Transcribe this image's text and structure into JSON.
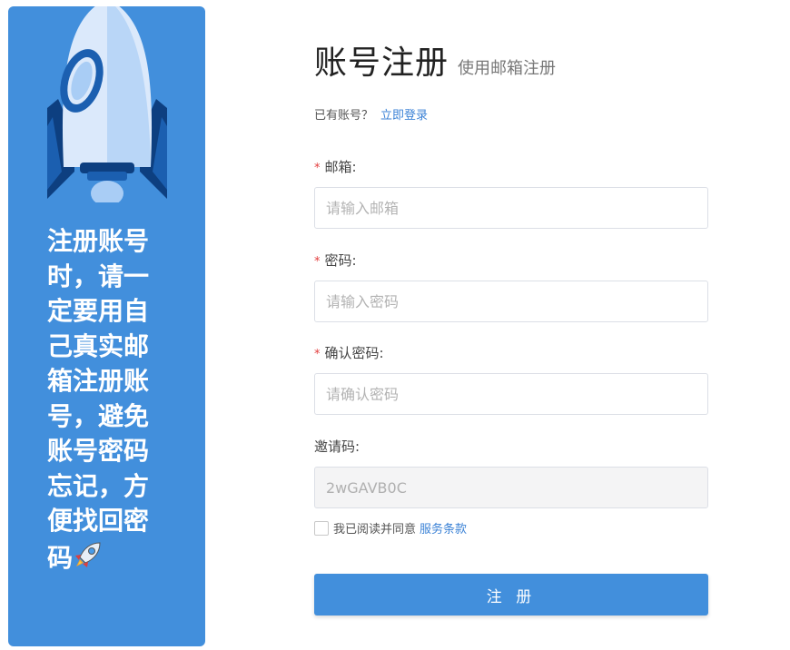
{
  "promo": {
    "text": "注册账号时，请一定要用自己真实邮箱注册账号，避免账号密码忘记，方便找回密码",
    "emoji": "rocket-icon",
    "bg_color": "#428fdc"
  },
  "header": {
    "title": "账号注册",
    "subtitle": "使用邮箱注册"
  },
  "login_prompt": {
    "text": "已有账号？",
    "link_label": "立即登录"
  },
  "fields": {
    "email": {
      "label": "邮箱:",
      "required_mark": "*",
      "placeholder": "请输入邮箱",
      "value": ""
    },
    "password": {
      "label": "密码:",
      "required_mark": "*",
      "placeholder": "请输入密码",
      "value": ""
    },
    "confirm_password": {
      "label": "确认密码:",
      "required_mark": "*",
      "placeholder": "请确认密码",
      "value": ""
    },
    "invite_code": {
      "label": "邀请码:",
      "value": "2wGAVB0C"
    }
  },
  "agreement": {
    "text": "我已阅读并同意",
    "link_label": "服务条款",
    "checked": false
  },
  "submit": {
    "label": "注 册"
  },
  "colors": {
    "accent": "#428fdc",
    "link": "#3b82d6",
    "required": "#e23c3c"
  }
}
